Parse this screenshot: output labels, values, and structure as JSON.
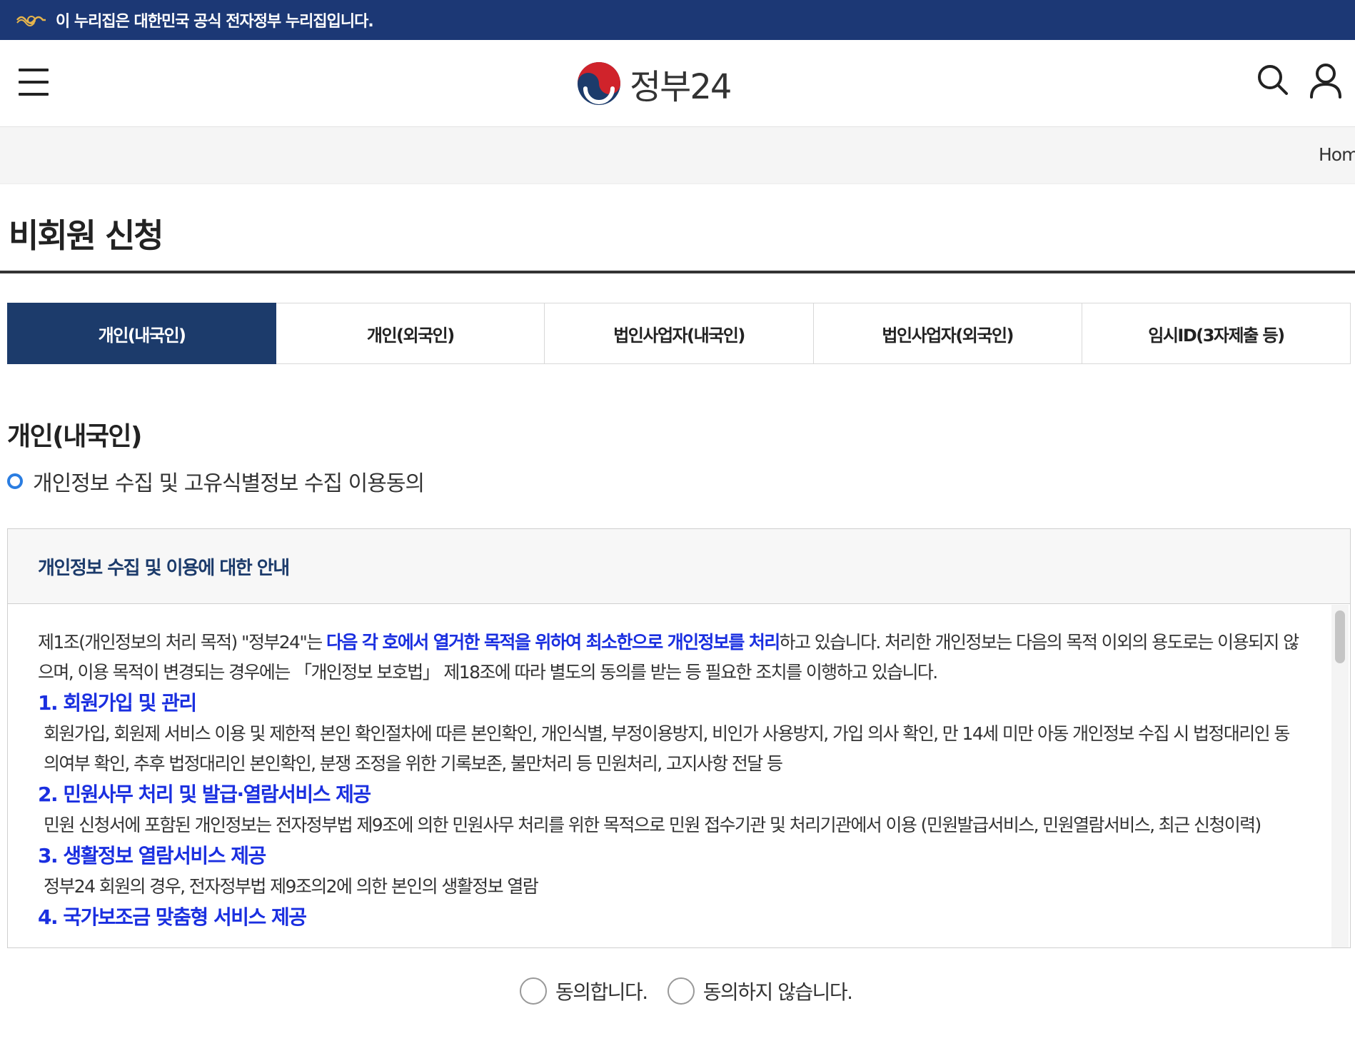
{
  "gov_banner": {
    "text": "이 누리집은 대한민국 공식 전자정부 누리집입니다.",
    "icon": "gov-wave-mark-icon"
  },
  "header": {
    "logo_text": "정부24",
    "logo_icon": "taegeuk-emblem-icon",
    "menu_icon": "hamburger-menu-icon",
    "search_icon": "search-icon",
    "user_icon": "user-icon"
  },
  "breadcrumb": {
    "home": "Hom"
  },
  "page": {
    "title": "비회원 신청"
  },
  "tabs": [
    {
      "label": "개인(내국인)",
      "active": true
    },
    {
      "label": "개인(외국인)",
      "active": false
    },
    {
      "label": "법인사업자(내국인)",
      "active": false
    },
    {
      "label": "법인사업자(외국인)",
      "active": false
    },
    {
      "label": "임시ID(3자제출 등)",
      "active": false
    }
  ],
  "section": {
    "title": "개인(내국인)",
    "subtitle": "개인정보 수집 및 고유식별정보 수집 이용동의"
  },
  "terms": {
    "heading": "개인정보 수집 및 이용에 대한 안내",
    "intro_a": "제1조(개인정보의 처리 목적) \"정부24\"는 ",
    "intro_hl": "다음 각 호에서 열거한 목적을 위하여 최소한으로 개인정보를 처리",
    "intro_b": "하고 있습니다. 처리한 개인정보는 다음의 목적 이외의 용도로는 이용되지 않으며, 이용 목적이 변경되는 경우에는 「개인정보 보호법」 제18조에 따라 별도의 동의를 받는 등 필요한 조치를 이행하고 있습니다.",
    "items": [
      {
        "title": "1. 회원가입 및 관리",
        "desc": "회원가입, 회원제 서비스 이용 및 제한적 본인 확인절차에 따른 본인확인, 개인식별, 부정이용방지, 비인가 사용방지, 가입 의사 확인, 만 14세 미만 아동 개인정보 수집 시 법정대리인 동의여부 확인, 추후 법정대리인 본인확인, 분쟁 조정을 위한 기록보존, 불만처리 등 민원처리, 고지사항 전달 등"
      },
      {
        "title": "2. 민원사무 처리 및 발급·열람서비스 제공",
        "desc": "민원 신청서에 포함된 개인정보는 전자정부법 제9조에 의한 민원사무 처리를 위한 목적으로 민원 접수기관 및 처리기관에서 이용 (민원발급서비스, 민원열람서비스, 최근 신청이력)"
      },
      {
        "title": "3. 생활정보 열람서비스 제공",
        "desc": "정부24 회원의 경우, 전자정부법 제9조의2에 의한 본인의 생활정보 열람"
      },
      {
        "title": "4. 국가보조금 맞춤형 서비스 제공",
        "desc": ""
      }
    ]
  },
  "consent": {
    "agree": "동의합니다.",
    "disagree": "동의하지 않습니다."
  }
}
